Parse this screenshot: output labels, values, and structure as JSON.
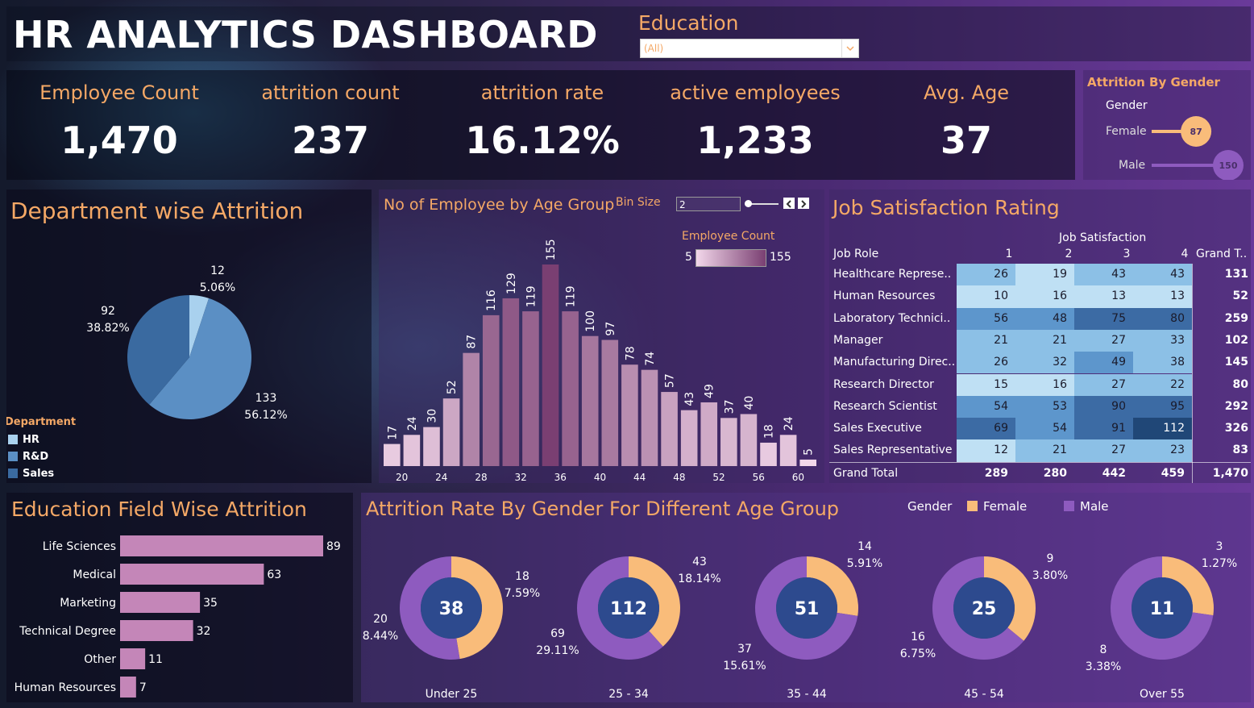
{
  "header": {
    "title": "HR ANALYTICS DASHBOARD"
  },
  "filter": {
    "label": "Education",
    "value": "(All)"
  },
  "kpis": [
    {
      "label": "Employee Count",
      "value": "1,470"
    },
    {
      "label": "attrition  count",
      "value": "237"
    },
    {
      "label": "attrition rate",
      "value": "16.12%"
    },
    {
      "label": "active employees",
      "value": "1,233"
    },
    {
      "label": "Avg. Age",
      "value": "37"
    }
  ],
  "gender_attrition": {
    "title": "Attrition By Gender",
    "legend_title": "Gender",
    "rows": [
      {
        "label": "Female",
        "value": 87,
        "color": "#f9bc7a"
      },
      {
        "label": "Male",
        "value": 150,
        "color": "#8e5bbf"
      }
    ]
  },
  "department": {
    "title": "Department wise Attrition",
    "legend_title": "Department",
    "legend": [
      {
        "label": "HR",
        "color": "#a9d1ee"
      },
      {
        "label": "R&D",
        "color": "#5b8fc4"
      },
      {
        "label": "Sales",
        "color": "#3a6aa0"
      }
    ],
    "labels": [
      {
        "value": "12",
        "pct": "5.06%"
      },
      {
        "value": "133",
        "pct": "56.12%"
      },
      {
        "value": "92",
        "pct": "38.82%"
      }
    ]
  },
  "age_group": {
    "title": "No of Employee by Age Group",
    "bin_label": "Bin Size",
    "bin_value": "2",
    "legend_title": "Employee Count",
    "legend_min": "5",
    "legend_max": "155",
    "x_ticks": [
      "20",
      "24",
      "28",
      "32",
      "36",
      "40",
      "44",
      "48",
      "52",
      "56",
      "60"
    ]
  },
  "job_satisfaction": {
    "title": "Job Satisfaction Rating",
    "col_group": "Job Satisfaction",
    "row_header": "Job Role",
    "columns": [
      "1",
      "2",
      "3",
      "4"
    ],
    "total_header": "Grand T..",
    "rows": [
      {
        "role": "Healthcare Represe..",
        "v": [
          "26",
          "19",
          "43",
          "43"
        ],
        "total": "131"
      },
      {
        "role": "Human Resources",
        "v": [
          "10",
          "16",
          "13",
          "13"
        ],
        "total": "52"
      },
      {
        "role": "Laboratory Technici..",
        "v": [
          "56",
          "48",
          "75",
          "80"
        ],
        "total": "259"
      },
      {
        "role": "Manager",
        "v": [
          "21",
          "21",
          "27",
          "33"
        ],
        "total": "102"
      },
      {
        "role": "Manufacturing Direc..",
        "v": [
          "26",
          "32",
          "49",
          "38"
        ],
        "total": "145"
      },
      {
        "role": "Research Director",
        "v": [
          "15",
          "16",
          "27",
          "22"
        ],
        "total": "80"
      },
      {
        "role": "Research Scientist",
        "v": [
          "54",
          "53",
          "90",
          "95"
        ],
        "total": "292"
      },
      {
        "role": "Sales Executive",
        "v": [
          "69",
          "54",
          "91",
          "112"
        ],
        "total": "326"
      },
      {
        "role": "Sales Representative",
        "v": [
          "12",
          "21",
          "27",
          "23"
        ],
        "total": "83"
      }
    ],
    "grand_total_label": "Grand Total",
    "grand_totals": [
      "289",
      "280",
      "442",
      "459"
    ],
    "grand_total": "1,470"
  },
  "education_field": {
    "title": "Education Field Wise Attrition"
  },
  "gender_age": {
    "title": "Attrition Rate By Gender For Different Age Group",
    "legend_title": "Gender",
    "legend": [
      {
        "label": "Female",
        "color": "#f9bc7a"
      },
      {
        "label": "Male",
        "color": "#8e5bbf"
      }
    ],
    "groups": [
      {
        "name": "Under 25",
        "total": "38",
        "female": 18,
        "female_pct": "7.59%",
        "male": 20,
        "male_pct": "8.44%"
      },
      {
        "name": "25 - 34",
        "total": "112",
        "female": 43,
        "female_pct": "18.14%",
        "male": 69,
        "male_pct": "29.11%"
      },
      {
        "name": "35 - 44",
        "total": "51",
        "female": 14,
        "female_pct": "5.91%",
        "male": 37,
        "male_pct": "15.61%"
      },
      {
        "name": "45 - 54",
        "total": "25",
        "female": 9,
        "female_pct": "3.80%",
        "male": 16,
        "male_pct": "6.75%"
      },
      {
        "name": "Over 55",
        "total": "11",
        "female": 3,
        "female_pct": "1.27%",
        "male": 8,
        "male_pct": "3.38%"
      }
    ]
  },
  "chart_data": [
    {
      "type": "pie",
      "title": "Department wise Attrition",
      "categories": [
        "HR",
        "R&D",
        "Sales"
      ],
      "values": [
        12,
        133,
        92
      ],
      "percent_labels": [
        "5.06%",
        "56.12%",
        "38.82%"
      ]
    },
    {
      "type": "bar",
      "title": "No of Employee by Age Group",
      "categories": [
        "18",
        "20",
        "22",
        "24",
        "26",
        "28",
        "30",
        "32",
        "34",
        "36",
        "38",
        "40",
        "42",
        "44",
        "46",
        "48",
        "50",
        "52",
        "54",
        "56",
        "58",
        "60"
      ],
      "values": [
        17,
        24,
        30,
        52,
        87,
        116,
        129,
        119,
        155,
        119,
        100,
        97,
        78,
        74,
        57,
        43,
        49,
        37,
        40,
        18,
        24,
        5
      ],
      "color_scale": {
        "min": 5,
        "max": 155
      }
    },
    {
      "type": "bar",
      "title": "Education Field Wise Attrition",
      "orientation": "horizontal",
      "categories": [
        "Life Sciences",
        "Medical",
        "Marketing",
        "Technical Degree",
        "Other",
        "Human Resources"
      ],
      "values": [
        89,
        63,
        35,
        32,
        11,
        7
      ]
    }
  ]
}
